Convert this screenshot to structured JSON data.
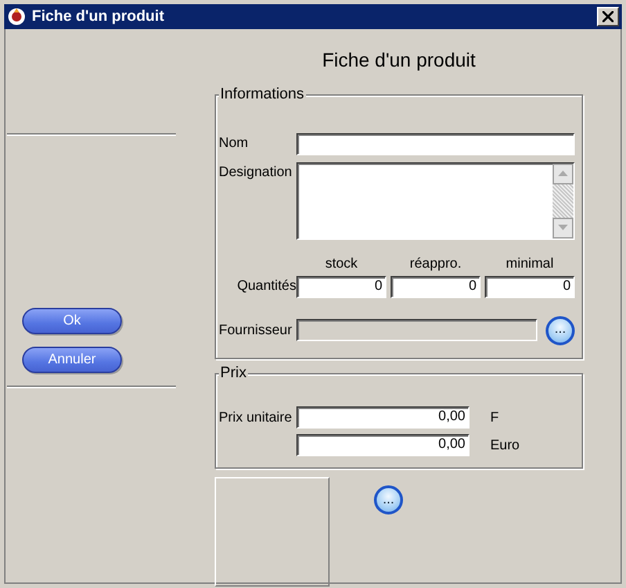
{
  "window": {
    "title": "Fiche d'un produit"
  },
  "heading": "Fiche d'un produit",
  "buttons": [
    {
      "label": "Ok"
    },
    {
      "label": "Annuler"
    }
  ],
  "informations": {
    "title": "Informations",
    "nom": {
      "label": "Nom"
    },
    "designation": {
      "label": "Designation"
    },
    "quantites": {
      "label": "Quantités",
      "columns": [
        "stock",
        "réappro.",
        "minimal"
      ],
      "values": [
        "0",
        "0",
        "0"
      ]
    },
    "fournisseur": {
      "label": "Fournisseur",
      "disabled": true,
      "browse": "..."
    }
  },
  "prix": {
    "title": "Prix",
    "rows": [
      {
        "label": "Prix unitaire",
        "value": "0,00",
        "unit": "F"
      },
      {
        "value": "0,00",
        "unit": "Euro"
      }
    ]
  },
  "image": {
    "browse": "..."
  }
}
